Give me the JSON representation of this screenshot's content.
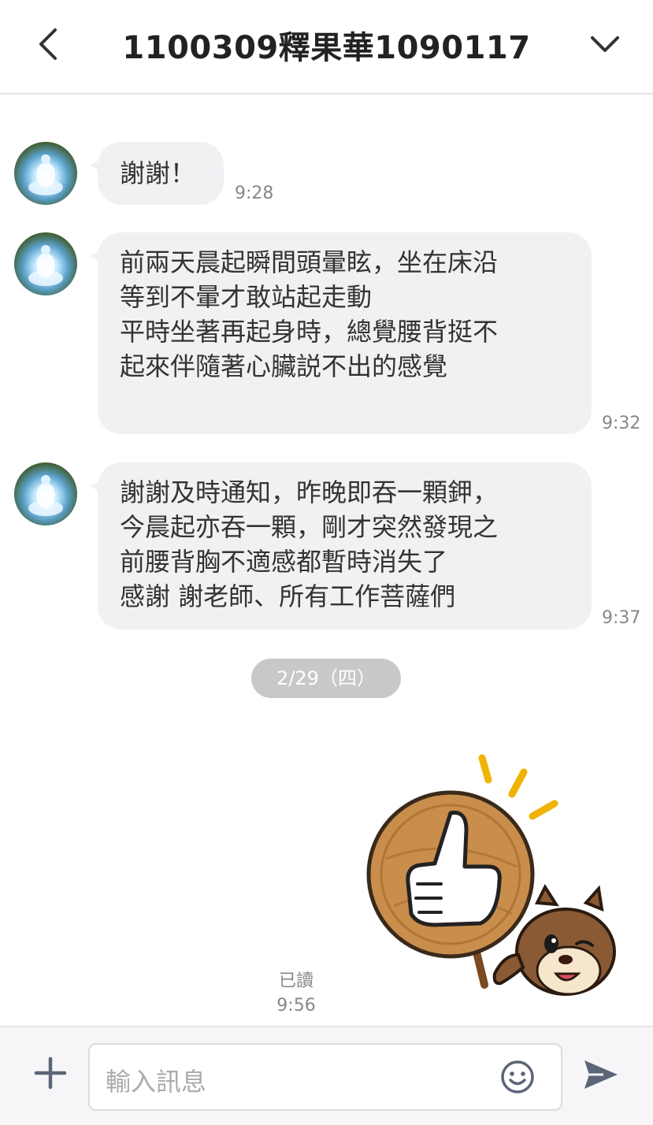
{
  "header": {
    "title": "1100309釋果華1090117",
    "back_icon": "chevron-left-icon",
    "menu_icon": "chevron-down-icon"
  },
  "messages": [
    {
      "sender": "other",
      "lines": [
        "謝謝！"
      ],
      "time": "9:28"
    },
    {
      "sender": "other",
      "lines": [
        "前兩天晨起瞬間頭暈眩，坐在床沿",
        "等到不暈才敢站起走動",
        "平時坐著再起身時，總覺腰背挺不",
        "起來伴隨著心臟説不出的感覺"
      ],
      "time": "9:32"
    },
    {
      "sender": "other",
      "lines": [
        "謝謝及時通知，昨晚即吞一顆鉀，",
        "今晨起亦吞一顆，剛才突然發現之",
        "前腰背胸不適感都暫時消失了",
        "感謝 謝老師、所有工作菩薩們"
      ],
      "time": "9:37"
    }
  ],
  "date_separator": "2/29（四）",
  "sent_sticker": {
    "icon": "thumbs-up-chipmunk-sticker",
    "read_label": "已讀",
    "time": "9:56"
  },
  "composer": {
    "placeholder": "輸入訊息",
    "plus_icon": "plus-icon",
    "emoji_icon": "emoji-icon",
    "send_icon": "send-icon"
  },
  "colors": {
    "bubble_bg": "#f0f1f3",
    "date_pill_bg": "#c8c8c8",
    "icon_color": "#5c6477"
  }
}
